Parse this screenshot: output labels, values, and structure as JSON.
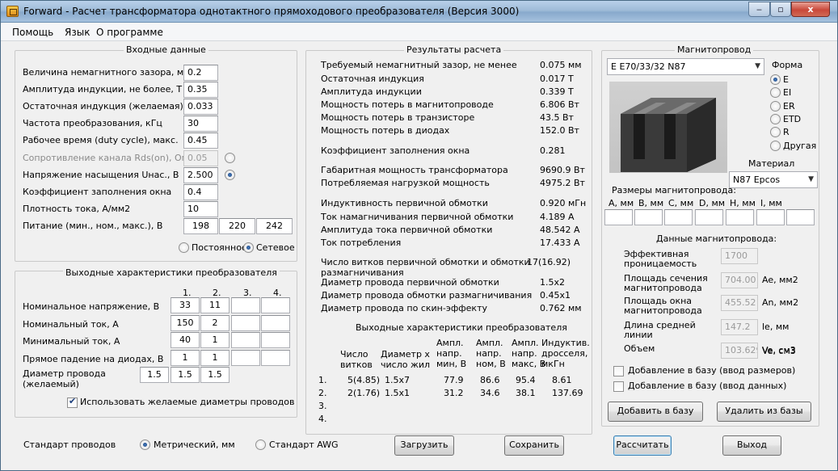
{
  "window": {
    "title": "Forward - Расчет трансформатора однотактного прямоходового преобразователя (Версия 3000)",
    "minimize": "‒",
    "maximize": "▫",
    "close": "x"
  },
  "menu": [
    "Помощь",
    "Язык",
    "О программе"
  ],
  "input": {
    "title": "Входные данные",
    "rows": [
      {
        "label": "Величина немагнитного зазора, мм",
        "value": "0.2"
      },
      {
        "label": "Амплитуда индукции, не более, Т",
        "value": "0.35"
      },
      {
        "label": "Остаточная индукция (желаемая), Т",
        "value": "0.033"
      },
      {
        "label": "Частота преобразования, кГц",
        "value": "30"
      },
      {
        "label": "Рабочее время (duty cycle), макс.",
        "value": "0.45"
      },
      {
        "label": "Сопротивление канала Rds(on), Ом",
        "value": "0.05"
      },
      {
        "label": "Напряжение насыщения Uнас., В",
        "value": "2.500"
      },
      {
        "label": "Коэффициент заполнения окна",
        "value": "0.4"
      },
      {
        "label": "Плотность тока, А/мм2",
        "value": "10"
      }
    ],
    "power_label": "Питание (мин., ном., макс.), В",
    "power": [
      "198",
      "220",
      "242"
    ],
    "supply_dc": "Постоянное",
    "supply_ac": "Сетевое"
  },
  "outputs": {
    "title": "Выходные характеристики преобразователя",
    "cols": [
      "1.",
      "2.",
      "3.",
      "4."
    ],
    "rows": [
      {
        "label": "Номинальное напряжение, В",
        "values": [
          "33",
          "11",
          "",
          ""
        ]
      },
      {
        "label": "Номинальный ток, А",
        "values": [
          "150",
          "2",
          "",
          ""
        ]
      },
      {
        "label": "Минимальный ток, А",
        "values": [
          "40",
          "1",
          "",
          ""
        ]
      },
      {
        "label": "Прямое падение на диодах, В",
        "values": [
          "1",
          "1",
          "",
          ""
        ]
      }
    ],
    "wire_label_1": "Диаметр провода",
    "wire_label_2": "(желаемый)",
    "wire_values": [
      "1.5",
      "1.5",
      "1.5"
    ],
    "use_desired": "Использовать желаемые диаметры проводов"
  },
  "results": {
    "title": "Результаты расчета",
    "rows": [
      {
        "label": "Требуемый немагнитный зазор, не менее",
        "value": "0.075 мм"
      },
      {
        "label": "Остаточная индукция",
        "value": "0.017 Т"
      },
      {
        "label": "Амплитуда индукции",
        "value": "0.339 Т"
      },
      {
        "label": "Мощность потерь в магнитопроводе",
        "value": "6.806 Вт"
      },
      {
        "label": "Мощность потерь в транзисторе",
        "value": "43.5 Вт"
      },
      {
        "label": "Мощность потерь в диодах",
        "value": "152.0 Вт"
      },
      {
        "label": "Коэффициент заполнения окна",
        "value": "0.281"
      },
      {
        "label": "Габаритная мощность трансформатора",
        "value": "9690.9 Вт"
      },
      {
        "label": "Потребляемая нагрузкой мощность",
        "value": "4975.2 Вт"
      },
      {
        "label": "Индуктивность первичной обмотки",
        "value": "0.920 мГн"
      },
      {
        "label": "Ток намагничивания первичной обмотки",
        "value": "4.189 А"
      },
      {
        "label": "Амплитуда тока первичной обмотки",
        "value": "48.542 А"
      },
      {
        "label": "Ток потребления",
        "value": "17.433 А"
      },
      {
        "label": "Число витков первичной обмотки и обмотки",
        "value": "17(16.92)"
      },
      {
        "label": "размагничивания",
        "value": ""
      },
      {
        "label": "Диаметр провода первичной обмотки",
        "value": "1.5x2"
      },
      {
        "label": "Диаметр провода обмотки размагничивания",
        "value": "0.45x1"
      },
      {
        "label": "Диаметр провода по скин-эффекту",
        "value": "0.762 мм"
      }
    ],
    "out_title": "Выходные характеристики преобразователя",
    "out_headers": [
      [
        "Число",
        "витков"
      ],
      [
        "Диаметр х",
        "число жил"
      ],
      [
        "Ампл.",
        "напр.",
        "мин, В"
      ],
      [
        "Ампл.",
        "напр.",
        "ном, В"
      ],
      [
        "Ампл.",
        "напр.",
        "макс, В"
      ],
      [
        "Индуктив.",
        "дросселя,",
        "мкГн"
      ]
    ],
    "out_rows": [
      {
        "n": "1.",
        "turns": "5(4.85)",
        "wire": "1.5x7",
        "vmin": "77.9",
        "vnom": "86.6",
        "vmax": "95.4",
        "ind": "8.61"
      },
      {
        "n": "2.",
        "turns": "2(1.76)",
        "wire": "1.5x1",
        "vmin": "31.2",
        "vnom": "34.6",
        "vmax": "38.1",
        "ind": "137.69"
      },
      {
        "n": "3.",
        "turns": "",
        "wire": "",
        "vmin": "",
        "vnom": "",
        "vmax": "",
        "ind": ""
      },
      {
        "n": "4.",
        "turns": "",
        "wire": "",
        "vmin": "",
        "vnom": "",
        "vmax": "",
        "ind": ""
      }
    ]
  },
  "core": {
    "title": "Магнитопровод",
    "selected": "E E70/33/32 N87",
    "shape_title": "Форма",
    "shapes": [
      "E",
      "EI",
      "ER",
      "ETD",
      "R",
      "Другая"
    ],
    "material_title": "Материал",
    "material": "N87 Epcos",
    "dims_title": "Размеры магнитопровода:",
    "dims": [
      "A, мм",
      "B, мм",
      "C, мм",
      "D, мм",
      "H, мм",
      "I, мм"
    ],
    "data_title": "Данные магнитопровода:",
    "data": [
      {
        "label": [
          "Эффективная",
          "проницаемость"
        ],
        "value": "1700",
        "unit": ""
      },
      {
        "label": [
          "Площадь сечения",
          "магнитопровода"
        ],
        "value": "704.00",
        "unit": "Ae, мм2"
      },
      {
        "label": [
          "Площадь окна",
          "магнитопровода"
        ],
        "value": "455.52",
        "unit": "An, мм2"
      },
      {
        "label": [
          "Длина средней",
          "линии"
        ],
        "value": "147.2",
        "unit": "le, мм"
      },
      {
        "label": [
          "Объем"
        ],
        "value": "103.629",
        "unit": "Ve, см3"
      }
    ],
    "add_dims": "Добавление в базу (ввод размеров)",
    "add_data": "Добавление в базу (ввод данных)",
    "add_btn": "Добавить в базу",
    "del_btn": "Удалить из базы"
  },
  "footer": {
    "wire_std": "Стандарт проводов",
    "metric": "Метрический, мм",
    "awg": "Стандарт AWG",
    "load": "Загрузить",
    "save": "Сохранить",
    "calc": "Рассчитать",
    "exit": "Выход"
  }
}
